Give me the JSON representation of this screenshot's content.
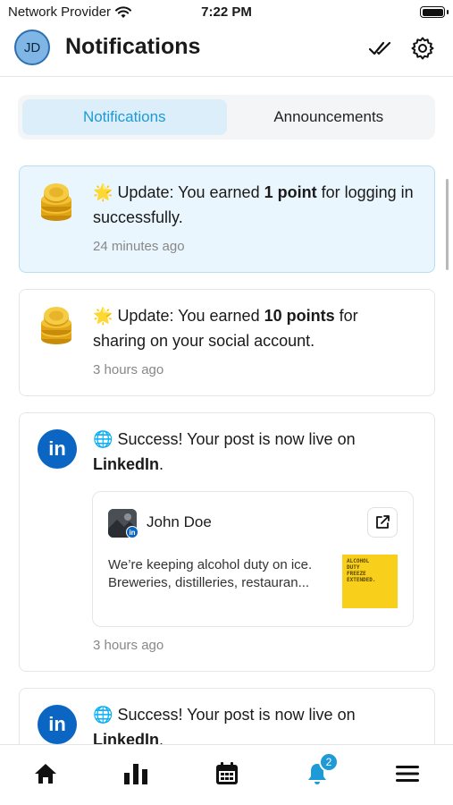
{
  "status_bar": {
    "carrier": "Network Provider",
    "time": "7:22 PM"
  },
  "header": {
    "avatar_initials": "JD",
    "title": "Notifications",
    "mark_all_icon": "double-check-icon",
    "settings_icon": "gear-icon"
  },
  "tabs": [
    {
      "label": "Notifications",
      "active": true
    },
    {
      "label": "Announcements",
      "active": false
    }
  ],
  "notifications": [
    {
      "icon": "coins-icon",
      "emoji": "🌟",
      "prefix": "Update: You earned ",
      "bold": "1 point",
      "suffix": " for logging in successfully.",
      "time": "24 minutes ago",
      "highlighted": true
    },
    {
      "icon": "coins-icon",
      "emoji": "🌟",
      "prefix": "Update: You earned ",
      "bold": "10 points",
      "suffix": " for sharing on your social account.",
      "time": "3 hours ago",
      "highlighted": false
    },
    {
      "icon": "linkedin-icon",
      "badge_text": "in",
      "emoji": "🌐",
      "prefix": "Success! Your post is now live on ",
      "bold": "LinkedIn",
      "suffix": ".",
      "time": "3 hours ago",
      "post": {
        "author": "John Doe",
        "body_line1": "We’re keeping alcohol duty on ice.",
        "body_line2": "Breweries, distilleries, restauran...",
        "thumb_lines": [
          "ALCOHOL",
          "DUTY",
          "FREEZE",
          "EXTENDED."
        ],
        "thumb_color": "#f8cf1b"
      }
    },
    {
      "icon": "linkedin-icon",
      "badge_text": "in",
      "emoji": "🌐",
      "prefix": "Success! Your post is now live on ",
      "bold": "LinkedIn",
      "suffix": "."
    }
  ],
  "bottom_nav": {
    "items": [
      "home-icon",
      "chart-icon",
      "calendar-icon",
      "bell-icon",
      "menu-icon"
    ],
    "bell_badge": "2",
    "active_color": "#1e9ad6"
  },
  "colors": {
    "accent": "#1e9ad6",
    "linkedin": "#0a66c2",
    "highlight_bg": "#eaf6fd"
  }
}
